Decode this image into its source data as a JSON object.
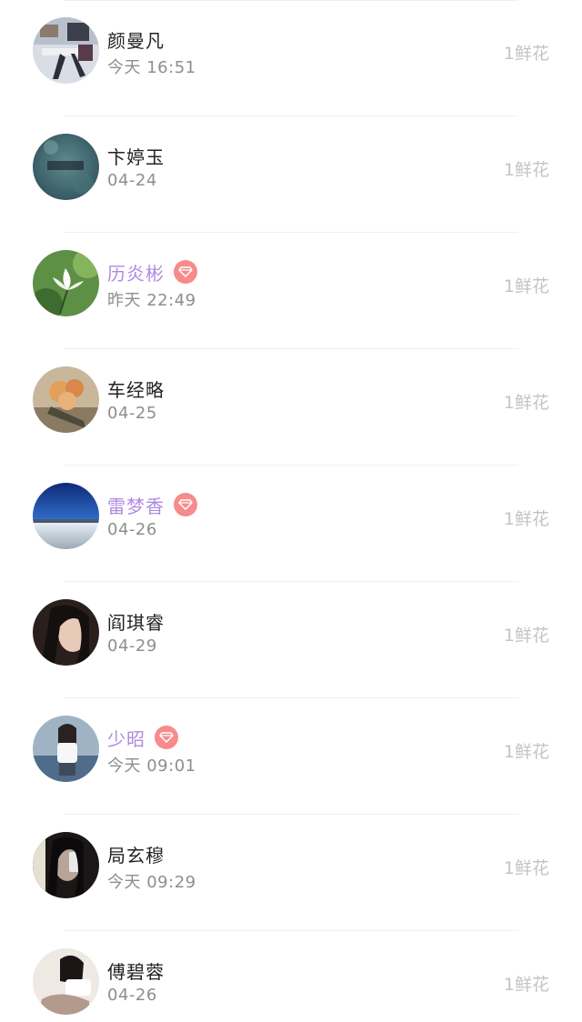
{
  "rows": [
    {
      "name": "颜曼凡",
      "time": "今天 16:51",
      "gift": "1鲜花",
      "vip": false,
      "avatar": "avatar-photo-desk"
    },
    {
      "name": "卞婷玉",
      "time": "04-24",
      "gift": "1鲜花",
      "vip": false,
      "avatar": "avatar-photo-teal-text"
    },
    {
      "name": "历炎彬",
      "time": "昨天 22:49",
      "gift": "1鲜花",
      "vip": true,
      "avatar": "avatar-photo-white-flower"
    },
    {
      "name": "车经略",
      "time": "04-25",
      "gift": "1鲜花",
      "vip": false,
      "avatar": "avatar-photo-bouquet"
    },
    {
      "name": "雷梦香",
      "time": "04-26",
      "gift": "1鲜花",
      "vip": true,
      "avatar": "avatar-photo-sky-lake"
    },
    {
      "name": "阎琪睿",
      "time": "04-29",
      "gift": "1鲜花",
      "vip": false,
      "avatar": "avatar-photo-girl-dark"
    },
    {
      "name": "少昭",
      "time": "今天 09:01",
      "gift": "1鲜花",
      "vip": true,
      "avatar": "avatar-photo-girl-bench"
    },
    {
      "name": "局玄穆",
      "time": "今天 09:29",
      "gift": "1鲜花",
      "vip": false,
      "avatar": "avatar-photo-mirror-selfie"
    },
    {
      "name": "傅碧蓉",
      "time": "04-26",
      "gift": "1鲜花",
      "vip": false,
      "avatar": "avatar-photo-girl-sitting"
    }
  ],
  "colors": {
    "name": "#222222",
    "vip_name": "#b08be0",
    "badge": "#f78b8b",
    "time": "#8e8e8e",
    "gift": "#c4c4c4"
  },
  "icons": {
    "vip_badge": "diamond-icon"
  }
}
